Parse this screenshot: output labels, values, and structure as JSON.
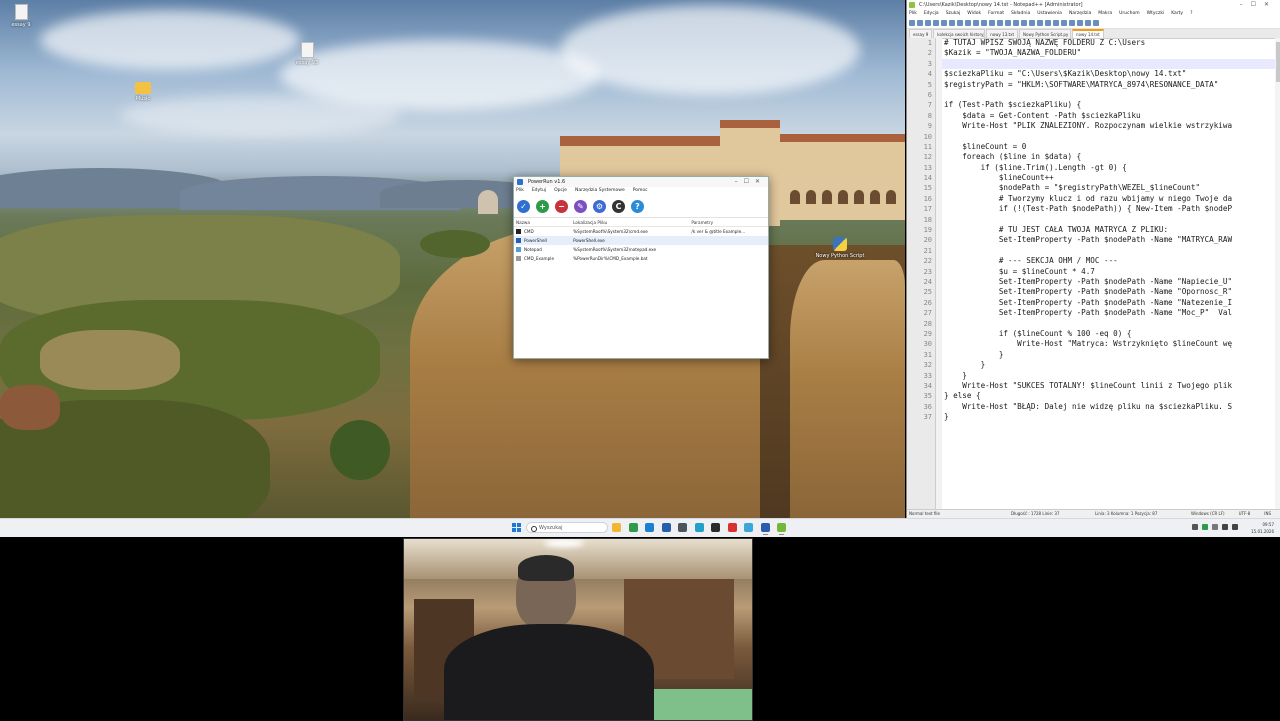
{
  "desktop": {
    "icons": [
      {
        "label": "essay 9",
        "type": "file"
      },
      {
        "label": "essay 93",
        "type": "file"
      },
      {
        "label": "Music",
        "type": "folder"
      },
      {
        "label": "Nowy Python Script",
        "type": "python"
      }
    ]
  },
  "powerrun": {
    "title": "PowerRun v1.6",
    "menu": [
      "Plik",
      "Edytuj",
      "Opcje",
      "Narzędzia Systemowe",
      "Pomoc"
    ],
    "toolbar_icons": [
      "run-icon",
      "add-icon",
      "remove-icon",
      "edit-icon",
      "settings-icon",
      "cmd-icon",
      "help-icon"
    ],
    "columns": [
      "Nazwa",
      "Lokalizacja Pliku",
      "Parametry"
    ],
    "rows": [
      {
        "name": "CMD",
        "path": "%SystemRoot%\\System32\\cmd.exe",
        "params": "/k ver & @title Example...",
        "color": "#222222"
      },
      {
        "name": "PowerShell",
        "path": "PowerShell.exe",
        "params": "",
        "color": "#2a5db0"
      },
      {
        "name": "Notepad",
        "path": "%SystemRoot%\\System32\\notepad.exe",
        "params": "",
        "color": "#5a9bd4"
      },
      {
        "name": "CMD_Example",
        "path": "%PowerRunDir%\\CMD_Example.bat",
        "params": "",
        "color": "#9a9a9a"
      }
    ],
    "selected_row": 1
  },
  "notepad": {
    "title": "C:\\Users\\Kazik\\Desktop\\nowy 14.txt - Notepad++ [Administrator]",
    "menu": [
      "Plik",
      "Edycja",
      "Szukaj",
      "Widok",
      "Format",
      "Składnia",
      "Ustawienia",
      "Narzędzia",
      "Makra",
      "Uruchom",
      "Wtyczki",
      "Karty",
      "?"
    ],
    "tabs": [
      "essay 9",
      "kolekcja swoich historyjek.txt",
      "nowy 13.txt",
      "Nowy Python Script.py",
      "nowy 14.txt"
    ],
    "active_tab": 4,
    "current_line": 3,
    "lines": [
      "# TUTAJ WPISZ SWOJĄ NAZWĘ FOLDERU Z C:\\Users",
      "$Kazik = \"TWOJA_NAZWA_FOLDERU\"",
      "",
      "$sciezkaPliku = \"C:\\Users\\$Kazik\\Desktop\\nowy 14.txt\"",
      "$registryPath = \"HKLM:\\SOFTWARE\\MATRYCA_8974\\RESONANCE_DATA\"",
      "",
      "if (Test-Path $sciezkaPliku) {",
      "    $data = Get-Content -Path $sciezkaPliku",
      "    Write-Host \"PLIK ZNALEZIONY. Rozpoczynam wielkie wstrzykiwa",
      "",
      "    $lineCount = 0",
      "    foreach ($line in $data) {",
      "        if ($line.Trim().Length -gt 0) {",
      "            $lineCount++",
      "            $nodePath = \"$registryPath\\WEZEL_$lineCount\"",
      "            # Tworzymy klucz i od razu wbijamy w niego Twoje da",
      "            if (!(Test-Path $nodePath)) { New-Item -Path $nodeP",
      "",
      "            # TU JEST CAŁA TWOJA MATRYCA Z PLIKU:",
      "            Set-ItemProperty -Path $nodePath -Name \"MATRYCA_RAW",
      "",
      "            # --- SEKCJA OHM / MOC ---",
      "            $u = $lineCount * 4.7",
      "            Set-ItemProperty -Path $nodePath -Name \"Napiecie_U\"",
      "            Set-ItemProperty -Path $nodePath -Name \"Opornosc_R\"",
      "            Set-ItemProperty -Path $nodePath -Name \"Natezenie_I",
      "            Set-ItemProperty -Path $nodePath -Name \"Moc_P\"  Val",
      "",
      "            if ($lineCount % 100 -eq 0) {",
      "                Write-Host \"Matryca: Wstrzyknięto $lineCount wę",
      "            }",
      "        }",
      "    }",
      "    Write-Host \"SUKCES TOTALNY! $lineCount linii z Twojego plik",
      "} else {",
      "    Write-Host \"BŁĄD: Dalej nie widzę pliku na $sciezkaPliku. S",
      "}"
    ],
    "status": {
      "type": "Normal text file",
      "length": "Długość : 1728    Linie: 37",
      "position": "Linia: 3    Kolumna: 1    Pozycja: 87",
      "eol": "Windows (CR LF)",
      "encoding": "UTF-8",
      "mode": "INS"
    }
  },
  "taskbar": {
    "search_placeholder": "Wyszukaj",
    "pinned": [
      {
        "name": "file-explorer-icon",
        "color": "#f2b632"
      },
      {
        "name": "chrome-icon",
        "color": "#2e9b4a"
      },
      {
        "name": "edge-icon",
        "color": "#1d7fd1"
      },
      {
        "name": "mail-icon",
        "color": "#2760a8"
      },
      {
        "name": "settings-icon",
        "color": "#4a5560"
      },
      {
        "name": "photos-icon",
        "color": "#22a0c6"
      },
      {
        "name": "terminal-icon",
        "color": "#2b2b2b"
      },
      {
        "name": "app-red-icon",
        "color": "#d93030"
      },
      {
        "name": "app-cyan-icon",
        "color": "#3aa7d8"
      },
      {
        "name": "powershell-icon",
        "color": "#2a5db0"
      },
      {
        "name": "notepadpp-icon",
        "color": "#74b83b"
      }
    ],
    "time": "09:57",
    "date": "15.01.2026"
  }
}
